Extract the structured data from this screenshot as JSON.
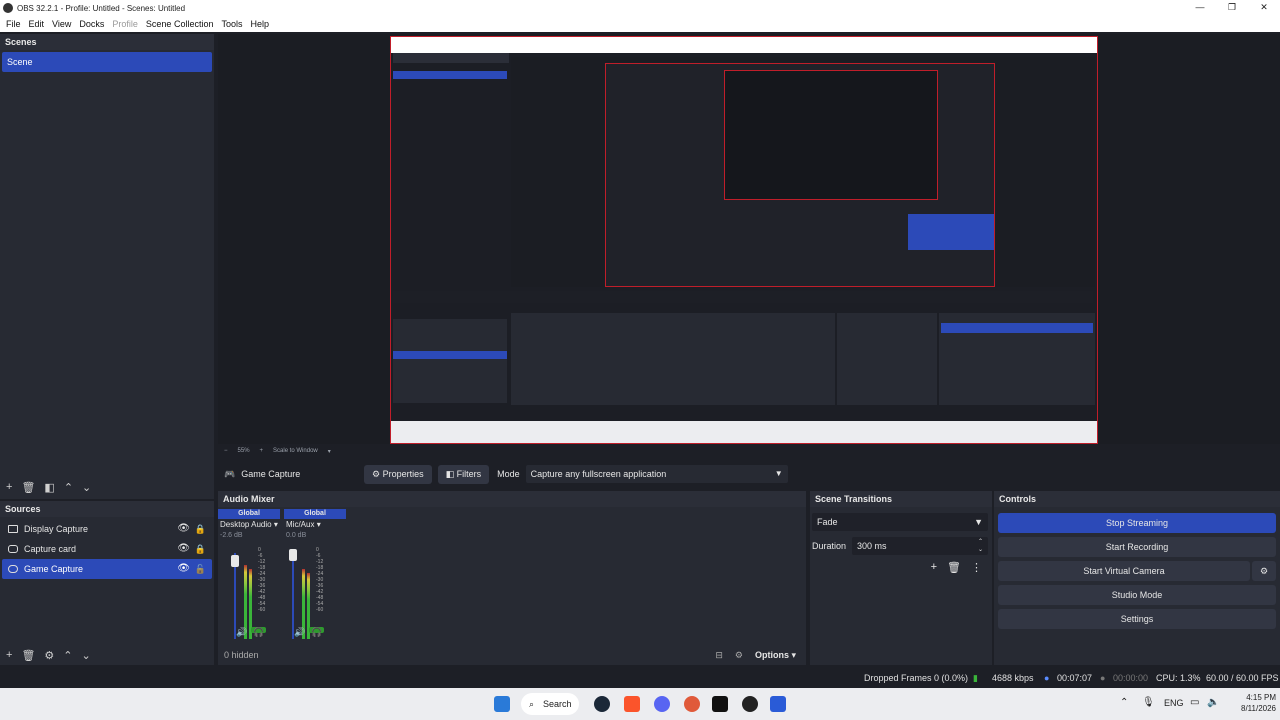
{
  "window": {
    "title": "OBS 32.2.1 - Profile: Untitled - Scenes: Untitled",
    "minimize": "—",
    "maximize": "❐",
    "close": "✕"
  },
  "menu": [
    "File",
    "Edit",
    "View",
    "Docks",
    "Profile",
    "Scene Collection",
    "Tools",
    "Help"
  ],
  "scenes": {
    "title": "Scenes",
    "items": [
      "Scene"
    ]
  },
  "sources": {
    "title": "Sources",
    "items": [
      {
        "name": "Display Capture",
        "icon": "monitor-icon"
      },
      {
        "name": "Capture card",
        "icon": "camera-icon"
      },
      {
        "name": "Game Capture",
        "icon": "gamepad-icon"
      }
    ]
  },
  "preview_bar": {
    "zoom": "55%",
    "scale": "Scale to Window"
  },
  "context": {
    "source": "Game Capture",
    "properties": "Properties",
    "filters": "Filters",
    "mode_label": "Mode",
    "mode_value": "Capture any fullscreen application"
  },
  "mixer": {
    "title": "Audio Mixer",
    "channels": [
      {
        "head": "Global",
        "name": "Desktop Audio",
        "db": "-2.6 dB",
        "level": 0.72
      },
      {
        "head": "Global",
        "name": "Mic/Aux",
        "db": "0.0 dB",
        "level": 0.6
      }
    ],
    "scale": [
      "0",
      "-6",
      "-12",
      "-18",
      "-24",
      "-30",
      "-36",
      "-42",
      "-48",
      "-54",
      "-60"
    ],
    "hidden": "0 hidden",
    "options": "Options"
  },
  "transitions": {
    "title": "Scene Transitions",
    "type": "Fade",
    "duration_label": "Duration",
    "duration_value": "300 ms"
  },
  "controls": {
    "title": "Controls",
    "stop_streaming": "Stop Streaming",
    "start_recording": "Start Recording",
    "start_virtual_camera": "Start Virtual Camera",
    "studio_mode": "Studio Mode",
    "settings": "Settings"
  },
  "status": {
    "dropped": "Dropped Frames 0 (0.0%)",
    "bitrate": "4688 kbps",
    "stream_time": "00:07:07",
    "rec_time": "00:00:00",
    "cpu": "CPU: 1.3%",
    "fps": "60.00 / 60.00 FPS"
  },
  "taskbar": {
    "search": "Search",
    "lang": "ENG",
    "time": "4:15 PM",
    "date": "8/11/2026"
  },
  "colors": {
    "accent": "#2c4ab8",
    "panel": "#272a33",
    "background": "#1d1f26",
    "capture_border": "#c01e2a"
  }
}
